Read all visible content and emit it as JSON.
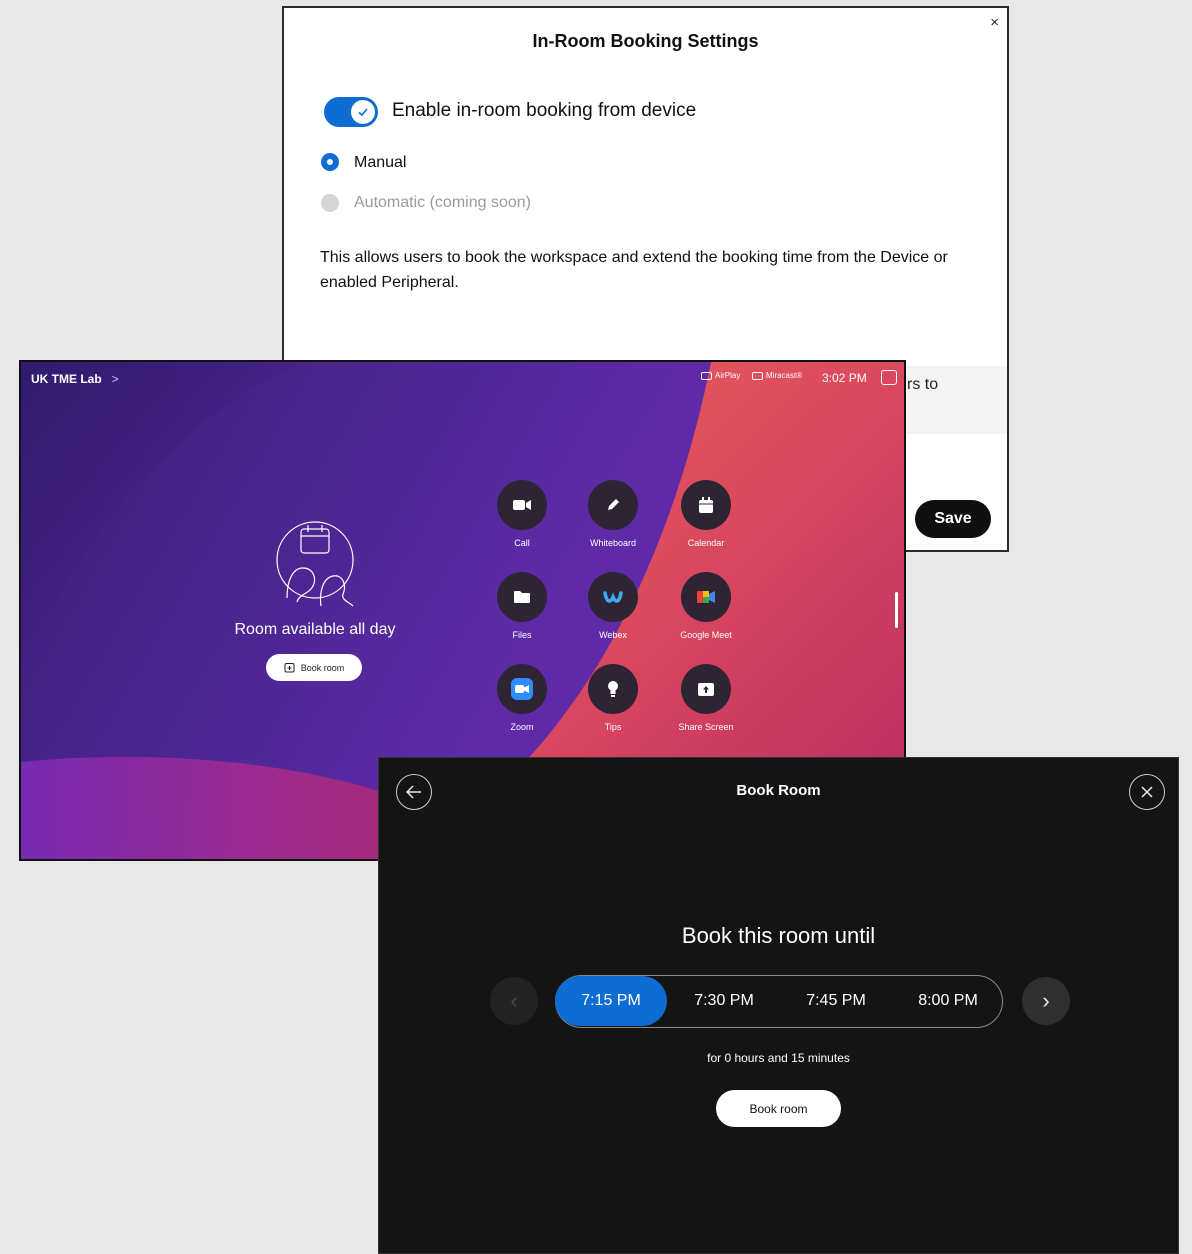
{
  "settings": {
    "title": "In-Room Booking Settings",
    "close": "×",
    "toggle_label": "Enable in-room booking from device",
    "toggle_on": true,
    "radio_manual": "Manual",
    "radio_automatic": "Automatic (coming soon)",
    "description": "This allows users to book the workspace and extend the booking time from the Device or enabled Peripheral.",
    "partial_text": "rs to",
    "save_label": "Save"
  },
  "device": {
    "room_name": "UK TME Lab",
    "room_chevron": ">",
    "airplay": "AirPlay",
    "miracast": "Miracast®",
    "time": "3:02 PM",
    "availability": "Room available all day",
    "book_room": "Book room",
    "apps": [
      {
        "label": "Call",
        "icon": "video-camera-icon"
      },
      {
        "label": "Whiteboard",
        "icon": "pencil-icon"
      },
      {
        "label": "Calendar",
        "icon": "calendar-icon"
      },
      {
        "label": "Files",
        "icon": "folder-icon"
      },
      {
        "label": "Webex",
        "icon": "webex-icon"
      },
      {
        "label": "Google Meet",
        "icon": "google-meet-icon"
      },
      {
        "label": "Zoom",
        "icon": "zoom-icon"
      },
      {
        "label": "Tips",
        "icon": "lightbulb-icon"
      },
      {
        "label": "Share Screen",
        "icon": "share-screen-icon"
      }
    ]
  },
  "book_room": {
    "title": "Book Room",
    "heading": "Book this room until",
    "times": [
      "7:15 PM",
      "7:30 PM",
      "7:45 PM",
      "8:00 PM"
    ],
    "selected_time": "7:15 PM",
    "duration": "for 0 hours and 15 minutes",
    "book_button": "Book room"
  },
  "colors": {
    "accent": "#0d6dd3",
    "dark_bg": "#141414"
  }
}
